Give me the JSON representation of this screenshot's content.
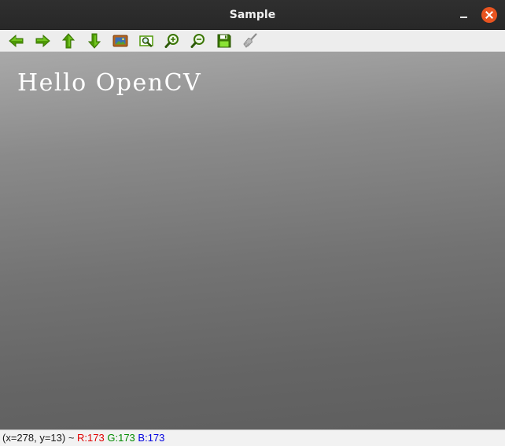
{
  "window": {
    "title": "Sample",
    "controls": [
      "minimize-icon",
      "close-icon"
    ]
  },
  "toolbar": {
    "buttons": [
      {
        "name": "pan-left",
        "icon": "arrow-left-icon"
      },
      {
        "name": "pan-right",
        "icon": "arrow-right-icon"
      },
      {
        "name": "pan-up",
        "icon": "arrow-up-icon"
      },
      {
        "name": "pan-down",
        "icon": "arrow-down-icon"
      },
      {
        "name": "zoom-original",
        "icon": "image-icon"
      },
      {
        "name": "zoom-fit",
        "icon": "zoom-fit-icon"
      },
      {
        "name": "zoom-in",
        "icon": "zoom-in-icon"
      },
      {
        "name": "zoom-out",
        "icon": "zoom-out-icon"
      },
      {
        "name": "save",
        "icon": "save-icon"
      },
      {
        "name": "properties",
        "icon": "brush-icon"
      }
    ]
  },
  "image": {
    "text": "Hello OpenCV"
  },
  "status": {
    "coords": "(x=278, y=13) ~",
    "r": "R:173",
    "g": "G:173",
    "b": "B:173"
  },
  "colors": {
    "titlebar": "#2c2c2c",
    "close_button": "#e95420",
    "toolbar_icon_green": "#4e9a06",
    "status_red": "#e00000",
    "status_green": "#008a00",
    "status_blue": "#0000e0"
  }
}
